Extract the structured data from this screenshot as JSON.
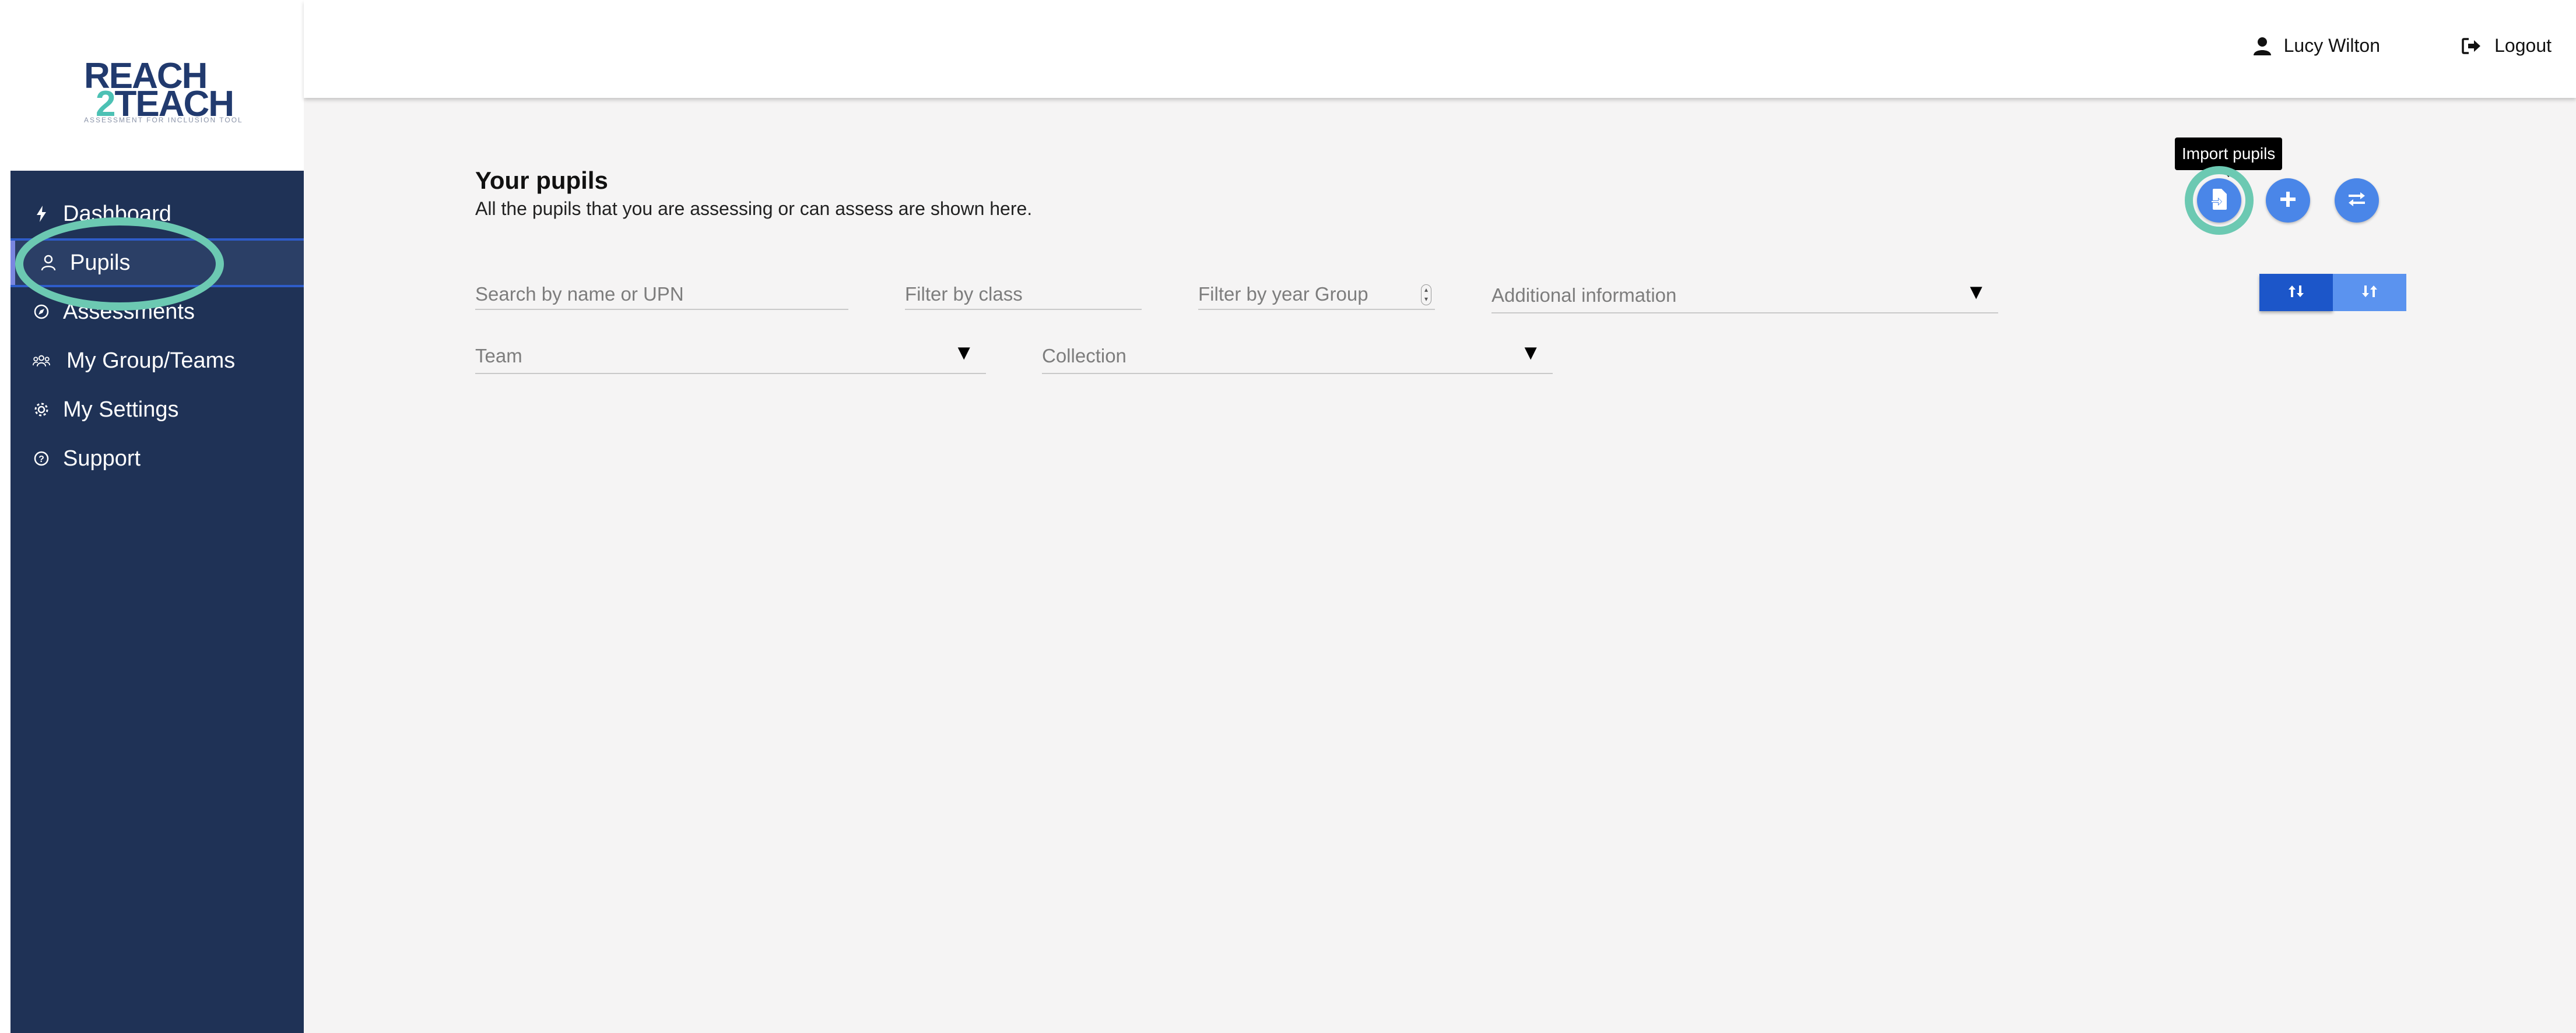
{
  "brand": {
    "line1": "REACH",
    "line2_num": "2",
    "line2_text": "TEACH",
    "tagline": "ASSESSMENT FOR INCLUSION TOOL",
    "primary_color": "#213a6e",
    "accent_color": "#4cc1b4"
  },
  "sidebar": {
    "items": [
      {
        "label": "Dashboard",
        "icon": "bolt-icon"
      },
      {
        "label": "Pupils",
        "icon": "user-icon",
        "active": true
      },
      {
        "label": "Assessments",
        "icon": "compass-icon"
      },
      {
        "label": "My Group/Teams",
        "icon": "group-icon"
      },
      {
        "label": "My Settings",
        "icon": "gear-icon"
      },
      {
        "label": "Support",
        "icon": "question-icon"
      }
    ],
    "bg_color": "#1f3256"
  },
  "topbar": {
    "user_name": "Lucy Wilton",
    "logout_label": "Logout"
  },
  "main": {
    "title": "Your pupils",
    "subtitle": "All the pupils that you are assessing or can assess are shown here.",
    "filters": {
      "search_placeholder": "Search by name or UPN",
      "class_placeholder": "Filter by class",
      "year_placeholder": "Filter by year Group",
      "additional_info_label": "Additional information",
      "team_label": "Team",
      "collection_label": "Collection"
    },
    "actions": {
      "import_tooltip": "Import pupils",
      "import_icon": "file-import-icon",
      "add_icon": "plus-icon",
      "transfer_icon": "swap-icon",
      "button_color": "#4a86e8"
    },
    "sort": {
      "asc_icon": "sort-asc-icon",
      "desc_icon": "sort-desc-icon"
    }
  },
  "highlight_color": "#6cc9b2"
}
